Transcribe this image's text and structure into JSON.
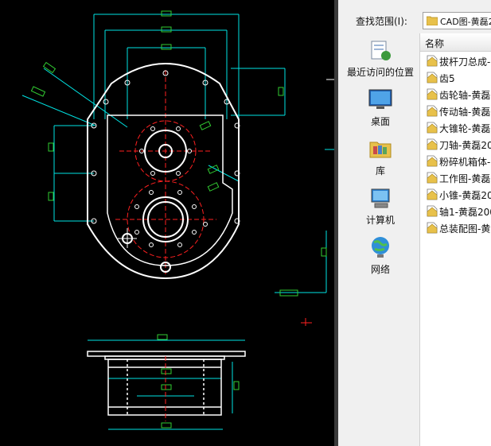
{
  "dialog": {
    "look_in_label": "查找范围(I):",
    "current_folder": "CAD图-黄磊2",
    "places": [
      {
        "label": "最近访问的位置",
        "icon": "recent-places-icon"
      },
      {
        "label": "桌面",
        "icon": "desktop-icon"
      },
      {
        "label": "库",
        "icon": "library-icon"
      },
      {
        "label": "计算机",
        "icon": "computer-icon"
      },
      {
        "label": "网络",
        "icon": "network-icon"
      }
    ],
    "column_header": "名称",
    "files": [
      "拔杆刀总成-",
      "齿5",
      "齿轮轴-黄磊",
      "传动轴-黄磊",
      "大锥轮-黄磊",
      "刀轴-黄磊20",
      "粉碎机箱体-",
      "工作图-黄磊",
      "小锥-黄磊20",
      "轴1-黄磊200",
      "总装配图-黄"
    ]
  },
  "colors": {
    "cad_background": "#000000",
    "geometry": "#ffffff",
    "dimensions": "#00e5e5",
    "dimension_text": "#32cd32",
    "centerlines": "#ff2020",
    "dialog_background": "#f0f0f0"
  }
}
